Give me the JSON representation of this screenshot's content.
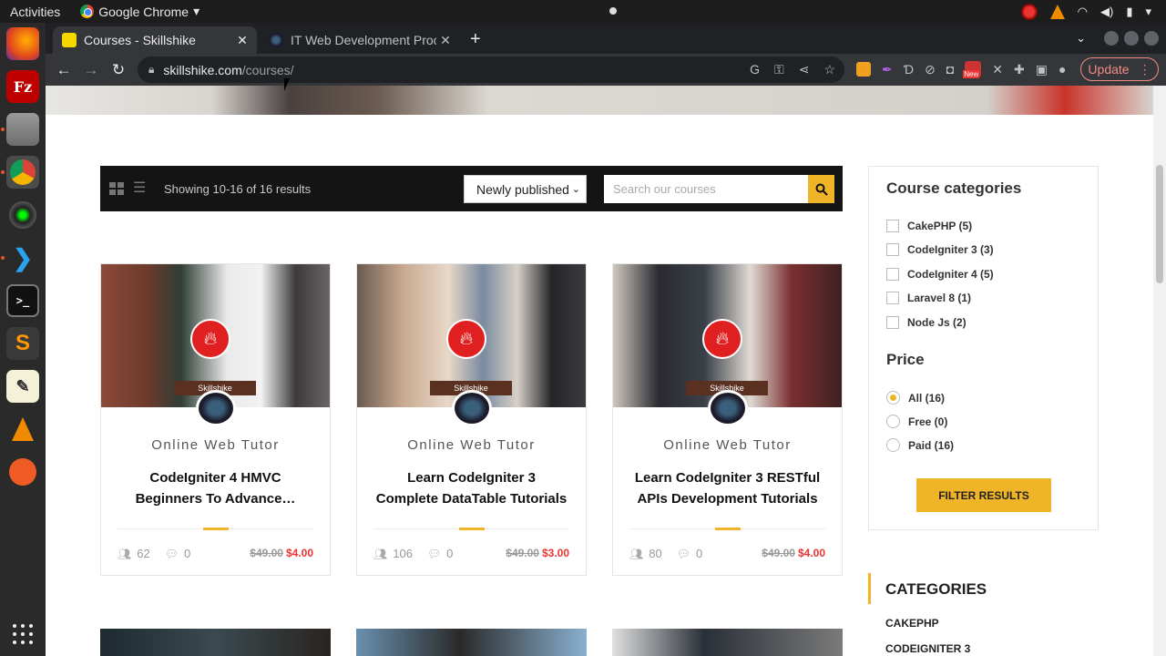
{
  "os": {
    "activities": "Activities",
    "app_name": "Google Chrome"
  },
  "dock": {
    "apps": [
      "firefox-icon",
      "filezilla-icon",
      "files-icon",
      "chrome-icon",
      "camera-icon",
      "vscode-icon",
      "terminal-icon",
      "sublime-icon",
      "text-editor-icon",
      "vlc-icon",
      "postman-icon"
    ]
  },
  "tabs": [
    {
      "title": "Courses - Skillshike",
      "active": true
    },
    {
      "title": "IT Web Development Proc",
      "active": false
    }
  ],
  "address": {
    "host": "skillshike.com",
    "path": "/courses/"
  },
  "toolbar": {
    "update_label": "Update",
    "new_badge": "New"
  },
  "filter": {
    "result_count": "Showing 10-16 of 16 results",
    "sort_value": "Newly published",
    "search_placeholder": "Search our courses"
  },
  "courses": [
    {
      "author": "Online Web Tutor",
      "title": "CodeIgniter 4 HMVC Beginners To Advance…",
      "students": "62",
      "comments": "0",
      "old_price": "$49.00",
      "price": "$4.00",
      "logo_label": "CodeIgniter",
      "banner": "Skillshike"
    },
    {
      "author": "Online Web Tutor",
      "title": "Learn CodeIgniter 3 Complete DataTable Tutorials",
      "students": "106",
      "comments": "0",
      "old_price": "$49.00",
      "price": "$3.00",
      "logo_label": "CodeIgniter",
      "banner": "Skillshike"
    },
    {
      "author": "Online Web Tutor",
      "title": "Learn CodeIgniter 3 RESTful APIs Development Tutorials",
      "students": "80",
      "comments": "0",
      "old_price": "$49.00",
      "price": "$4.00",
      "logo_label": "CodeIgniter",
      "banner": "Skillshike"
    }
  ],
  "sidebar": {
    "categories_title": "Course categories",
    "categories": [
      "CakePHP (5)",
      "CodeIgniter 3 (3)",
      "CodeIgniter 4 (5)",
      "Laravel 8 (1)",
      "Node Js (2)"
    ],
    "price_title": "Price",
    "prices": [
      "All (16)",
      "Free (0)",
      "Paid (16)"
    ],
    "selected_price": "All (16)",
    "filter_button": "FILTER RESULTS"
  },
  "categories_widget": {
    "title": "CATEGORIES",
    "items": [
      "CAKEPHP",
      "CODEIGNITER 3"
    ]
  },
  "colors": {
    "accent": "#f0b429",
    "sale_price": "#ee3333",
    "toolbar_bg": "#141414"
  }
}
